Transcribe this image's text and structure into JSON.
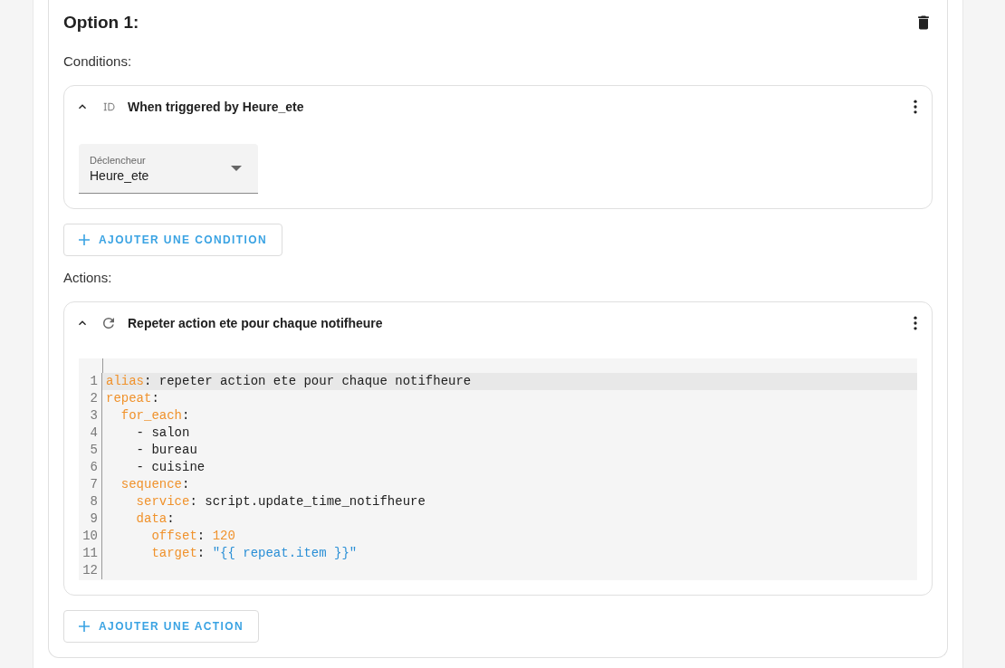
{
  "option": {
    "title": "Option 1:"
  },
  "conditions": {
    "label": "Conditions:",
    "items": [
      {
        "kind": "trigger",
        "title": "When triggered by Heure_ete",
        "expanded": true,
        "field": {
          "label": "Déclencheur",
          "value": "Heure_ete"
        }
      }
    ],
    "add_button": "AJOUTER UNE CONDITION"
  },
  "actions": {
    "label": "Actions:",
    "items": [
      {
        "kind": "repeat",
        "title": "Repeter action ete pour chaque notifheure",
        "expanded": true,
        "code": [
          {
            "number": "1",
            "active": true,
            "tokens": [
              {
                "kind": "key",
                "text": "alias"
              },
              {
                "kind": "plain",
                "text": ": repeter action ete pour chaque notifheure"
              }
            ]
          },
          {
            "number": "2",
            "active": false,
            "tokens": [
              {
                "kind": "key",
                "text": "repeat"
              },
              {
                "kind": "plain",
                "text": ":"
              }
            ]
          },
          {
            "number": "3",
            "active": false,
            "tokens": [
              {
                "kind": "key",
                "text": "  for_each"
              },
              {
                "kind": "plain",
                "text": ":"
              }
            ]
          },
          {
            "number": "4",
            "active": false,
            "tokens": [
              {
                "kind": "plain",
                "text": "    - salon"
              }
            ]
          },
          {
            "number": "5",
            "active": false,
            "tokens": [
              {
                "kind": "plain",
                "text": "    - bureau"
              }
            ]
          },
          {
            "number": "6",
            "active": false,
            "tokens": [
              {
                "kind": "plain",
                "text": "    - cuisine"
              }
            ]
          },
          {
            "number": "7",
            "active": false,
            "tokens": [
              {
                "kind": "key",
                "text": "  sequence"
              },
              {
                "kind": "plain",
                "text": ":"
              }
            ]
          },
          {
            "number": "8",
            "active": false,
            "tokens": [
              {
                "kind": "key",
                "text": "    service"
              },
              {
                "kind": "plain",
                "text": ": script.update_time_notifheure"
              }
            ]
          },
          {
            "number": "9",
            "active": false,
            "tokens": [
              {
                "kind": "key",
                "text": "    data"
              },
              {
                "kind": "plain",
                "text": ":"
              }
            ]
          },
          {
            "number": "10",
            "active": false,
            "tokens": [
              {
                "kind": "key",
                "text": "      offset"
              },
              {
                "kind": "plain",
                "text": ": "
              },
              {
                "kind": "number",
                "text": "120"
              }
            ]
          },
          {
            "number": "11",
            "active": false,
            "tokens": [
              {
                "kind": "key",
                "text": "      target"
              },
              {
                "kind": "plain",
                "text": ": "
              },
              {
                "kind": "string",
                "text": "\"{{ repeat.item }}\""
              }
            ]
          },
          {
            "number": "12",
            "active": false
          }
        ]
      }
    ],
    "add_button": "AJOUTER UNE ACTION"
  }
}
